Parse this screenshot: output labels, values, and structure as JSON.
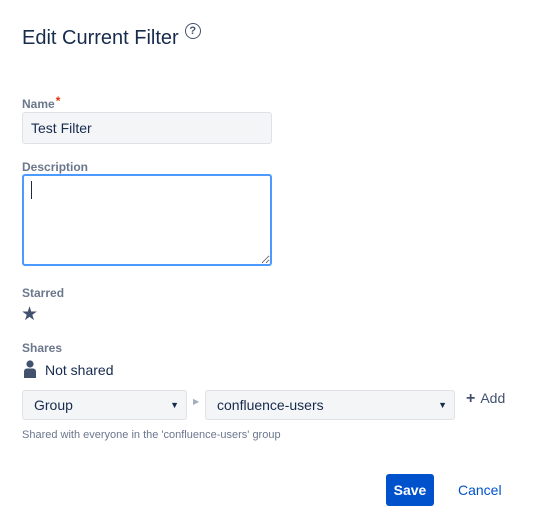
{
  "dialog": {
    "title": "Edit Current Filter",
    "help_icon": "question-circle-icon"
  },
  "name_field": {
    "label": "Name",
    "required_marker": "*",
    "value": "Test Filter"
  },
  "description_field": {
    "label": "Description",
    "value": ""
  },
  "starred": {
    "label": "Starred",
    "icon": "star-icon",
    "is_starred": true
  },
  "shares": {
    "label": "Shares",
    "icon": "person-icon",
    "status": "Not shared",
    "share_type": "Group",
    "group": "confluence-users",
    "add_label": "Add",
    "hint": "Shared with everyone in the 'confluence-users' group"
  },
  "buttons": {
    "save": "Save",
    "cancel": "Cancel"
  },
  "colors": {
    "primary": "#0052cc",
    "focus": "#4c9aff",
    "required": "#de350b"
  }
}
